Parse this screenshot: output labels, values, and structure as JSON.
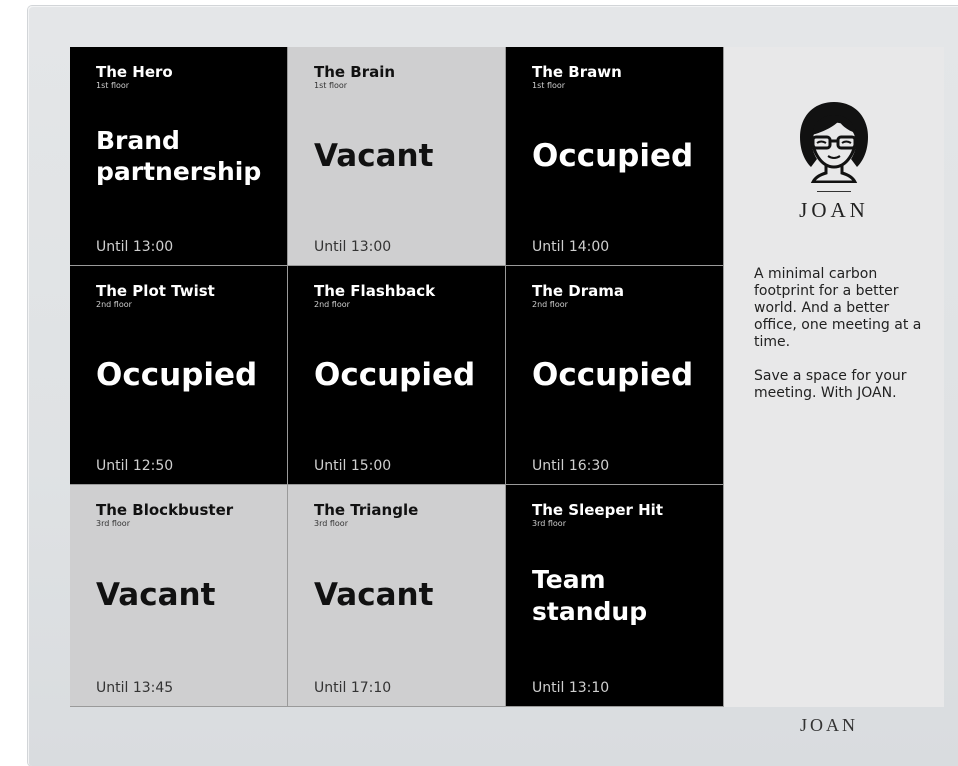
{
  "rooms": [
    {
      "name": "The Hero",
      "floor": "1st floor",
      "status": "Brand partnership",
      "until": "Until 13:00",
      "state": "occupied"
    },
    {
      "name": "The Brain",
      "floor": "1st floor",
      "status": "Vacant",
      "until": "Until 13:00",
      "state": "vacant"
    },
    {
      "name": "The Brawn",
      "floor": "1st floor",
      "status": "Occupied",
      "until": "Until 14:00",
      "state": "occupied"
    },
    {
      "name": "The Plot Twist",
      "floor": "2nd floor",
      "status": "Occupied",
      "until": "Until 12:50",
      "state": "occupied"
    },
    {
      "name": "The Flashback",
      "floor": "2nd floor",
      "status": "Occupied",
      "until": "Until 15:00",
      "state": "occupied"
    },
    {
      "name": "The Drama",
      "floor": "2nd floor",
      "status": "Occupied",
      "until": "Until 16:30",
      "state": "occupied"
    },
    {
      "name": "The Blockbuster",
      "floor": "3rd floor",
      "status": "Vacant",
      "until": "Until 13:45",
      "state": "vacant"
    },
    {
      "name": "The Triangle",
      "floor": "3rd floor",
      "status": "Vacant",
      "until": "Until 17:10",
      "state": "vacant"
    },
    {
      "name": "The Sleeper Hit",
      "floor": "3rd floor",
      "status": "Team standup",
      "until": "Until 13:10",
      "state": "occupied"
    }
  ],
  "side": {
    "brand": "JOAN",
    "logo_icon": "woman-with-glasses-icon",
    "tagline": "A minimal carbon footprint for a better world. And a better office, one meeting at a time.",
    "cta": "Save a space for your meeting. With JOAN."
  },
  "footer": {
    "brand": "JOAN"
  },
  "colors": {
    "occupied_bg": "#000000",
    "vacant_bg": "#cfcfd0",
    "side_bg": "#e8e8e9"
  }
}
